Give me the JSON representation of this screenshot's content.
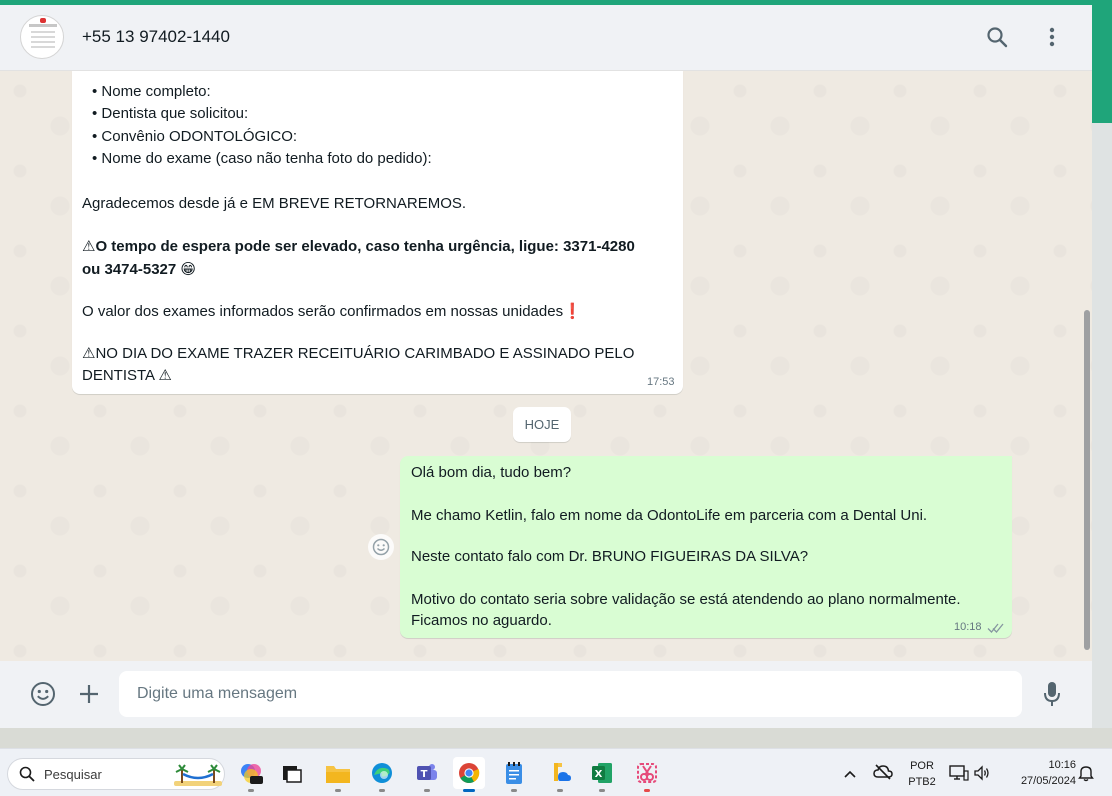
{
  "header": {
    "contact_name": "+55 13 97402-1440"
  },
  "incoming_message": {
    "lines": [
      "• Nome completo:",
      "• Dentista que solicitou:",
      "• Convênio ODONTOLÓGICO:",
      "• Nome do exame (caso não tenha foto do pedido):",
      "Agradecemos desde já e EM BREVE RETORNAREMOS.",
      "⚠O tempo de espera pode ser elevado, caso tenha urgência, ligue: 3371-4280",
      "ou 3474-5327 😁",
      "O valor dos exames informados serão confirmados em nossas unidades❗",
      "⚠NO DIA DO EXAME TRAZER RECEITUÁRIO CARIMBADO E ASSINADO PELO",
      "DENTISTA ⚠"
    ],
    "time": "17:53"
  },
  "day_divider": "HOJE",
  "outgoing_message": {
    "lines": [
      "Olá bom dia, tudo bem?",
      "Me chamo Ketlin, falo em nome da OdontoLife em parceria com a Dental Uni.",
      "Neste contato falo com Dr. BRUNO FIGUEIRAS DA SILVA?",
      "Motivo do contato seria sobre validação se está atendendo ao plano normalmente.",
      "Ficamos no aguardo."
    ],
    "time": "10:18",
    "status_icon": "double-check-icon"
  },
  "composer": {
    "placeholder": "Digite uma mensagem"
  },
  "taskbar": {
    "search_label": "Pesquisar",
    "language_line1": "POR",
    "language_line2": "PTB2",
    "clock_time": "10:16",
    "clock_date": "27/05/2024"
  },
  "colors": {
    "accent": "#1fa57a",
    "outgoing_bubble": "#d9fdd3",
    "incoming_bubble": "#ffffff",
    "chat_background": "#efeae2"
  }
}
